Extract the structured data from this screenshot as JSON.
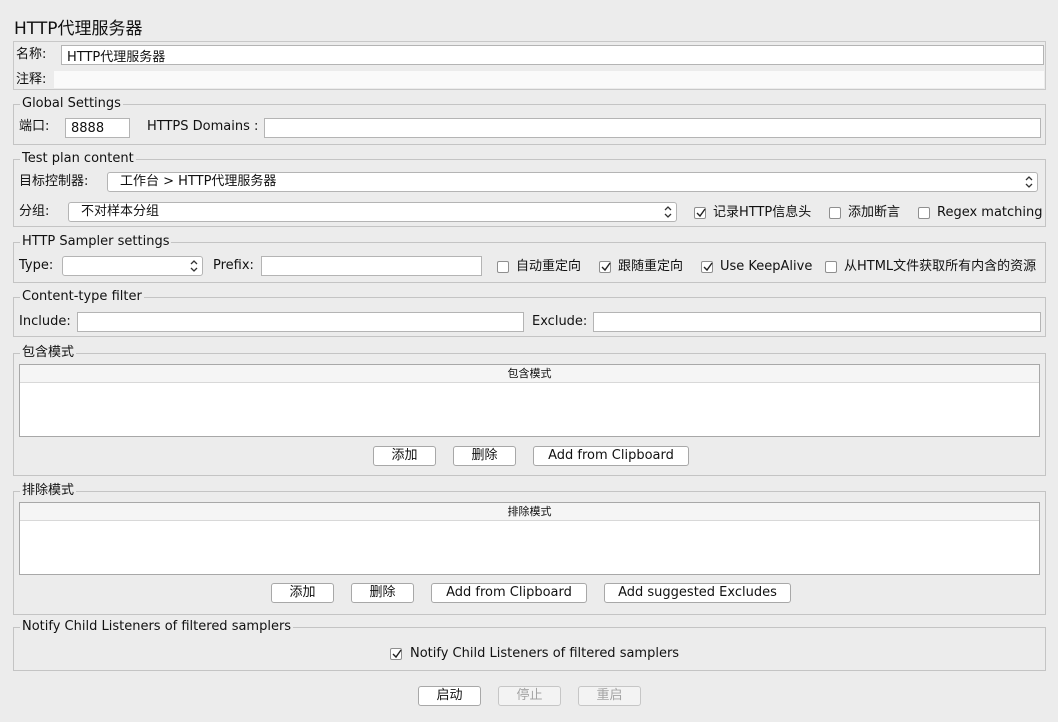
{
  "window": {
    "title": "HTTP代理服务器"
  },
  "name_section": {
    "name_label": "名称:",
    "name_value": "HTTP代理服务器",
    "comment_label": "注释:"
  },
  "global_settings": {
    "legend": "Global Settings",
    "port_label": "端口:",
    "port_value": "8888",
    "https_label": "HTTPS Domains :",
    "https_value": ""
  },
  "test_plan": {
    "legend": "Test plan content",
    "target_label": "目标控制器:",
    "target_value": "工作台 > HTTP代理服务器",
    "group_label": "分组:",
    "group_value": "不对样本分组",
    "record_headers": {
      "label": "记录HTTP信息头",
      "checked": true
    },
    "add_assertions": {
      "label": "添加断言",
      "checked": false
    },
    "regex_matching": {
      "label": "Regex matching",
      "checked": false
    }
  },
  "sampler_settings": {
    "legend": "HTTP Sampler settings",
    "type_label": "Type:",
    "type_value": "",
    "prefix_label": "Prefix:",
    "prefix_value": "",
    "auto_redirect": {
      "label": "自动重定向",
      "checked": false
    },
    "follow_redirect": {
      "label": "跟随重定向",
      "checked": true
    },
    "keepalive": {
      "label": "Use KeepAlive",
      "checked": true
    },
    "embedded": {
      "label": "从HTML文件获取所有内含的资源",
      "checked": false
    }
  },
  "content_filter": {
    "legend": "Content-type filter",
    "include_label": "Include:",
    "include_value": "",
    "exclude_label": "Exclude:",
    "exclude_value": ""
  },
  "include_patterns": {
    "legend": "包含模式",
    "column_header": "包含模式",
    "add": "添加",
    "delete": "删除",
    "clipboard": "Add from Clipboard"
  },
  "exclude_patterns": {
    "legend": "排除模式",
    "column_header": "排除模式",
    "add": "添加",
    "delete": "删除",
    "clipboard": "Add from Clipboard",
    "suggested": "Add suggested Excludes"
  },
  "notify": {
    "legend": "Notify Child Listeners of filtered samplers",
    "checkbox": {
      "label": "Notify Child Listeners of filtered samplers",
      "checked": true
    }
  },
  "controls": {
    "start": "启动",
    "stop": "停止",
    "restart": "重启"
  }
}
